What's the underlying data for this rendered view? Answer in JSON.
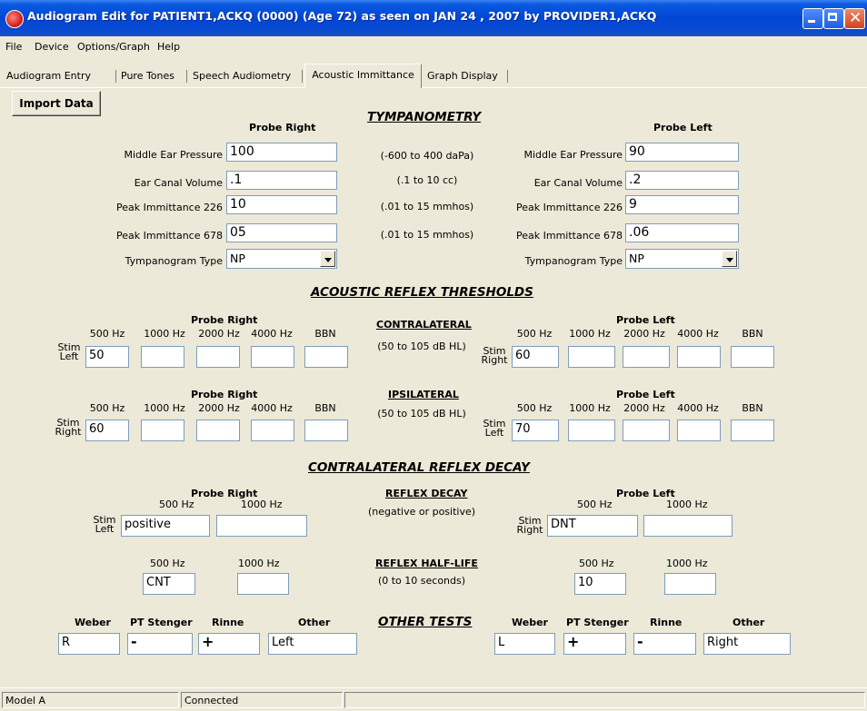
{
  "window": {
    "title": "Audiogram Edit for  PATIENT1,ACKQ (0000)  (Age 72) as seen on JAN 24 , 2007  by PROVIDER1,ACKQ"
  },
  "menu": [
    "File",
    "Device",
    "Options/Graph",
    "Help"
  ],
  "tabs": [
    "Audiogram Entry",
    "Pure Tones",
    "Speech Audiometry",
    "Acoustic Immittance",
    "Graph Display"
  ],
  "import_button": "Import Data",
  "tympanometry": {
    "title": "TYMPANOMETRY",
    "probe_right_label": "Probe Right",
    "probe_left_label": "Probe Left",
    "labels": {
      "mep": "Middle Ear Pressure",
      "ecv": "Ear Canal Volume",
      "pi226": "Peak Immittance 226",
      "pi678": "Peak Immittance 678",
      "type": "Tympanogram Type"
    },
    "ranges": {
      "mep": "(-600  to 400 daPa)",
      "ecv": "(.1 to 10 cc)",
      "pi226": "(.01 to 15 mmhos)",
      "pi678": "(.01 to 15 mmhos)"
    },
    "right": {
      "mep": "100",
      "ecv": ".1",
      "pi226": "10",
      "pi678": "05",
      "type": "NP"
    },
    "left": {
      "mep": "90",
      "ecv": ".2",
      "pi226": "9",
      "pi678": ".06",
      "type": "NP"
    }
  },
  "reflex_thresholds": {
    "title": "ACOUSTIC REFLEX THRESHOLDS",
    "probe_right": "Probe Right",
    "probe_left": "Probe Left",
    "freqs": [
      "500 Hz",
      "1000 Hz",
      "2000 Hz",
      "4000 Hz",
      "BBN"
    ],
    "stim_left": "Stim\nLeft",
    "stim_right": "Stim\nRight",
    "contralateral": {
      "title": "CONTRALATERAL",
      "range": "(50 to 105 dB HL)",
      "right": [
        "50",
        "",
        "",
        "",
        ""
      ],
      "left": [
        "60",
        "",
        "",
        "",
        ""
      ]
    },
    "ipsilateral": {
      "title": "IPSILATERAL",
      "range": "(50 to 105 dB HL)",
      "right": [
        "60",
        "",
        "",
        "",
        ""
      ],
      "left": [
        "70",
        "",
        "",
        "",
        ""
      ]
    }
  },
  "reflex_decay": {
    "title": "CONTRALATERAL REFLEX DECAY",
    "probe_right": "Probe Right",
    "probe_left": "Probe Left",
    "freq_500": "500 Hz",
    "freq_1000": "1000 Hz",
    "decay_title": "REFLEX DECAY",
    "decay_range": "(negative or positive)",
    "halflife_title": "REFLEX HALF-LIFE",
    "halflife_range": "(0 to 10 seconds)",
    "right_decay": [
      "positive",
      ""
    ],
    "left_decay": [
      "DNT",
      ""
    ],
    "right_halflife": [
      "CNT",
      ""
    ],
    "left_halflife": [
      "10",
      ""
    ]
  },
  "other_tests": {
    "title": "OTHER TESTS",
    "labels": [
      "Weber",
      "PT Stenger",
      "Rinne",
      "Other"
    ],
    "right": [
      "R",
      "-",
      "+",
      "Left"
    ],
    "left": [
      "L",
      "+",
      "-",
      "Right"
    ]
  },
  "status": {
    "model": "Model A",
    "connection": "Connected"
  }
}
